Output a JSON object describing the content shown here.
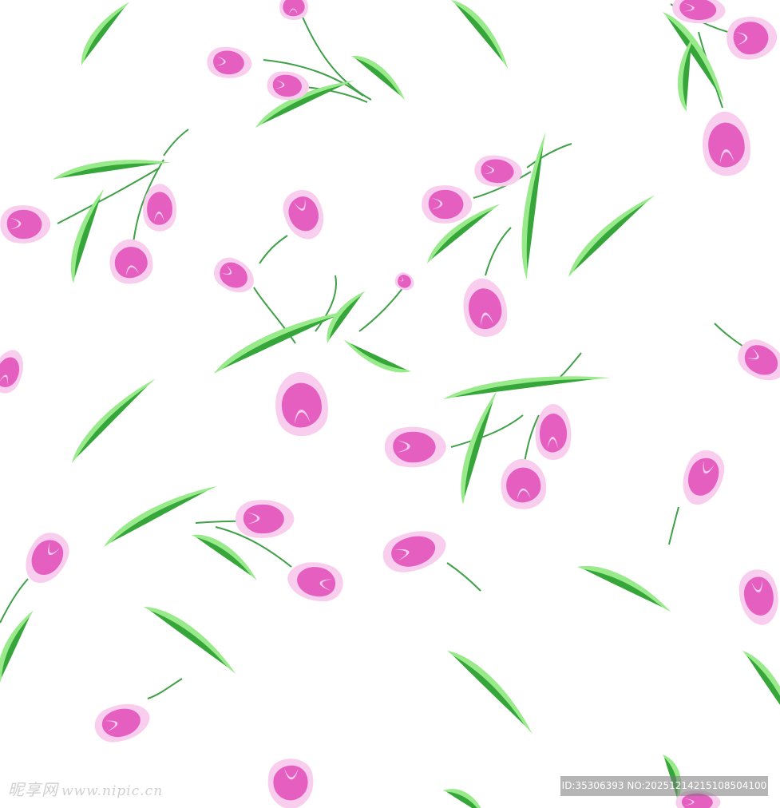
{
  "image": {
    "subject": "seamless tulip floral pattern",
    "background_color": "#ffffff"
  },
  "colors": {
    "petal_deep": "#e45fc0",
    "petal_light": "#f9cdee",
    "leaf_light": "#98ea8a",
    "leaf_dark": "#36a63a",
    "stem": "#3fa048"
  },
  "watermark": {
    "logo_text": "昵享网",
    "site_text": "www.nipic.cn"
  },
  "badge": {
    "text": "ID:35306393 NO:20251214215108504100"
  }
}
